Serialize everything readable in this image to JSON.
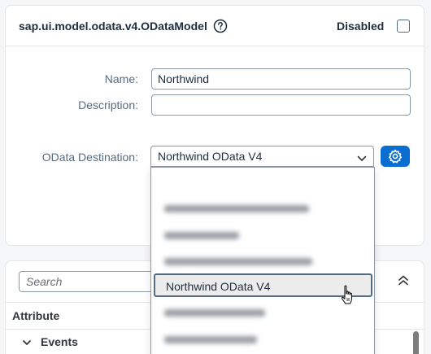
{
  "model": {
    "title": "sap.ui.model.odata.v4.ODataModel",
    "disabled_label": "Disabled",
    "disabled_checked": false
  },
  "form": {
    "name_label": "Name:",
    "name_value": "Northwind",
    "description_label": "Description:",
    "description_value": "",
    "destination_label": "OData Destination:",
    "destination_value": "Northwind OData V4"
  },
  "dropdown": {
    "blurred_items_count": 6,
    "selected_item": "Northwind OData V4"
  },
  "attributes": {
    "search_placeholder": "Search",
    "column_header": "Attribute",
    "events_label": "Events"
  },
  "icons": {
    "help": "help-circle-icon",
    "chevron": "chevron-down-icon",
    "settings": "settings-gear-icon",
    "collapse": "collapse-all-icon",
    "cursor": "hand-cursor-icon"
  },
  "colors": {
    "accent": "#0a6ed1",
    "text_primary": "#1d2d3e",
    "label": "#556b82"
  }
}
